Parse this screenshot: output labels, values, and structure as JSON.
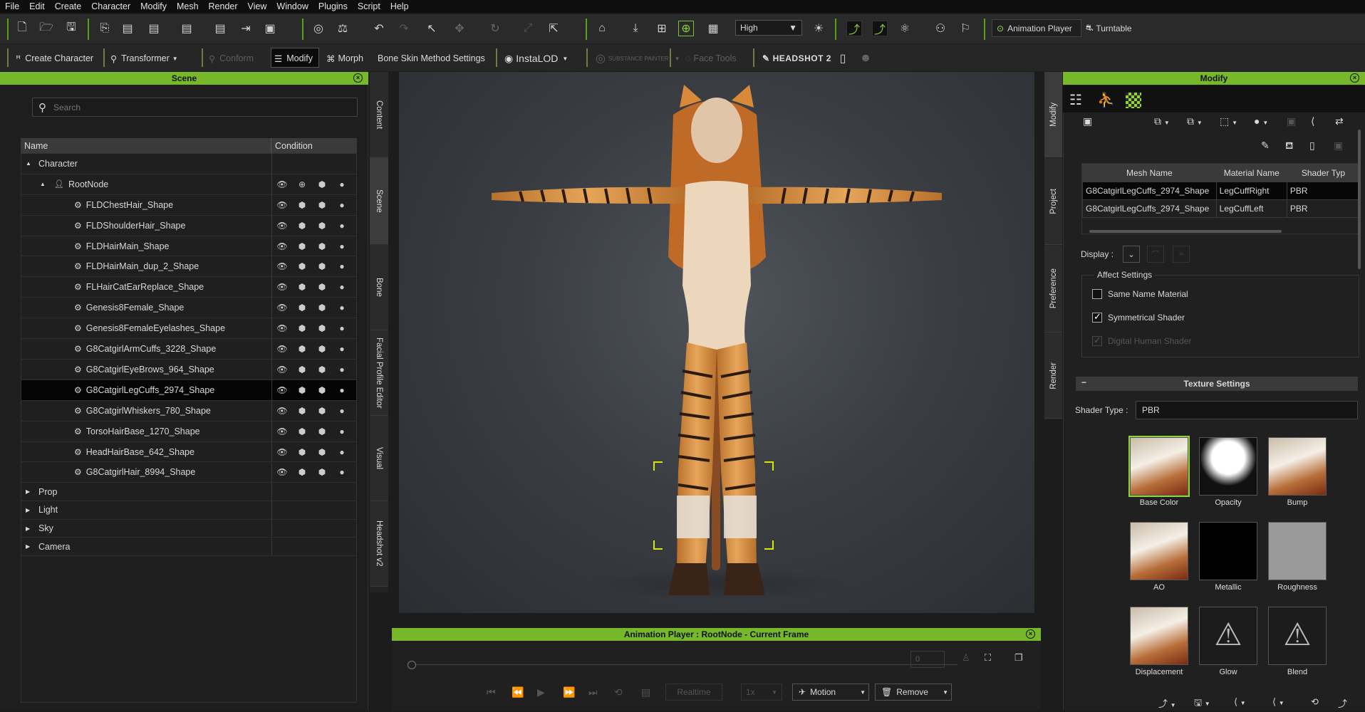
{
  "menu": [
    "File",
    "Edit",
    "Create",
    "Character",
    "Modify",
    "Mesh",
    "Render",
    "View",
    "Window",
    "Plugins",
    "Script",
    "Help"
  ],
  "toolbar": {
    "quality": "High",
    "animation_player": "Animation Player",
    "turntable": "Turntable"
  },
  "toolbar2": {
    "create_character": "Create Character",
    "transformer": "Transformer",
    "conform": "Conform",
    "modify": "Modify",
    "morph": "Morph",
    "bone_skin": "Bone Skin Method Settings",
    "instalod": "InstaLOD",
    "substance": "SUBSTANCE PAINTER",
    "face_tools": "Face Tools",
    "headshot2": "HEADSHOT 2"
  },
  "scene": {
    "title": "Scene",
    "search_placeholder": "Search",
    "col_name": "Name",
    "col_condition": "Condition",
    "rows": [
      {
        "label": "Character",
        "indent": 0,
        "arrow": "▲"
      },
      {
        "label": "RootNode",
        "indent": 1,
        "arrow": "▲"
      },
      {
        "label": "FLDChestHair_Shape",
        "indent": 2
      },
      {
        "label": "FLDShoulderHair_Shape",
        "indent": 2
      },
      {
        "label": "FLDHairMain_Shape",
        "indent": 2
      },
      {
        "label": "FLDHairMain_dup_2_Shape",
        "indent": 2
      },
      {
        "label": "FLHairCatEarReplace_Shape",
        "indent": 2
      },
      {
        "label": "Genesis8Female_Shape",
        "indent": 2
      },
      {
        "label": "Genesis8FemaleEyelashes_Shape",
        "indent": 2
      },
      {
        "label": "G8CatgirlArmCuffs_3228_Shape",
        "indent": 2
      },
      {
        "label": "G8CatgirlEyeBrows_964_Shape",
        "indent": 2
      },
      {
        "label": "G8CatgirlLegCuffs_2974_Shape",
        "indent": 2,
        "selected": true
      },
      {
        "label": "G8CatgirlWhiskers_780_Shape",
        "indent": 2
      },
      {
        "label": "TorsoHairBase_1270_Shape",
        "indent": 2
      },
      {
        "label": "HeadHairBase_642_Shape",
        "indent": 2
      },
      {
        "label": "G8CatgirlHair_8994_Shape",
        "indent": 2
      },
      {
        "label": "Prop",
        "indent": 0,
        "arrow": "▶"
      },
      {
        "label": "Light",
        "indent": 0,
        "arrow": "▶"
      },
      {
        "label": "Sky",
        "indent": 0,
        "arrow": "▶"
      },
      {
        "label": "Camera",
        "indent": 0,
        "arrow": "▶"
      }
    ]
  },
  "side_tabs": [
    "Content",
    "Scene",
    "Bone",
    "Facial Profile Editor",
    "Visual",
    "Headshot v2"
  ],
  "right_tabs": [
    "Modify",
    "Project",
    "Preference",
    "Render"
  ],
  "animation": {
    "title": "Animation Player : RootNode - Current Frame",
    "frame": "0",
    "realtime": "Realtime",
    "speed": "1x",
    "motion": "Motion",
    "remove": "Remove"
  },
  "modify": {
    "title": "Modify",
    "table_headers": [
      "Mesh Name",
      "Material Name",
      "Shader Typ"
    ],
    "table_rows": [
      [
        "G8CatgirlLegCuffs_2974_Shape",
        "LegCuffRight",
        "PBR"
      ],
      [
        "G8CatgirlLegCuffs_2974_Shape",
        "LegCuffLeft",
        "PBR"
      ]
    ],
    "display_label": "Display :",
    "affect_settings": "Affect Settings",
    "same_name_material": "Same Name Material",
    "symmetrical_shader": "Symmetrical Shader",
    "digital_human_shader": "Digital Human Shader",
    "texture_settings": "Texture Settings",
    "shader_type_label": "Shader Type :",
    "shader_type_value": "PBR",
    "textures": [
      "Base Color",
      "Opacity",
      "Bump",
      "AO",
      "Metallic",
      "Roughness",
      "Displacement",
      "Glow",
      "Blend"
    ]
  },
  "colors": {
    "accent": "#76b82a"
  }
}
